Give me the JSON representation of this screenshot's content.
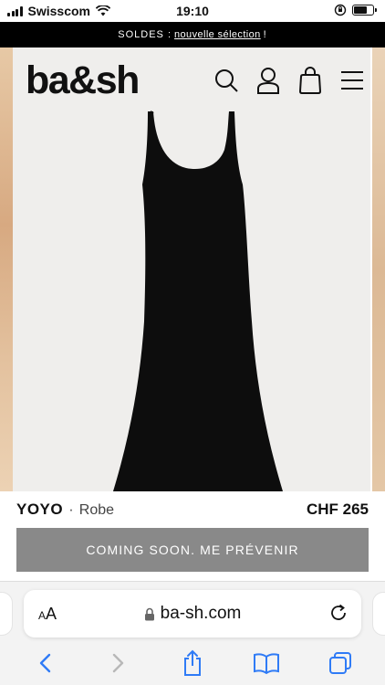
{
  "status_bar": {
    "carrier": "Swisscom",
    "time": "19:10",
    "battery_level": 0.7
  },
  "promo": {
    "prefix": "SOLDES :",
    "link": "nouvelle sélection",
    "suffix": "!"
  },
  "header": {
    "logo": "ba&sh",
    "icons": [
      "search-icon",
      "account-icon",
      "bag-icon",
      "menu-icon"
    ]
  },
  "product": {
    "name": "YOYO",
    "separator": "·",
    "type": "Robe",
    "price": "CHF 265",
    "cta_label": "COMING SOON. ME PRÉVENIR"
  },
  "browser": {
    "aa_small": "A",
    "aa_large": "A",
    "url": "ba-sh.com",
    "toolbar": [
      "back-icon",
      "forward-icon",
      "share-icon",
      "bookmarks-icon",
      "tabs-icon"
    ]
  },
  "colors": {
    "promo_bg": "#000000",
    "cta_bg": "#898989",
    "link_blue": "#2f7bf6",
    "image_bg": "#efeeec"
  }
}
